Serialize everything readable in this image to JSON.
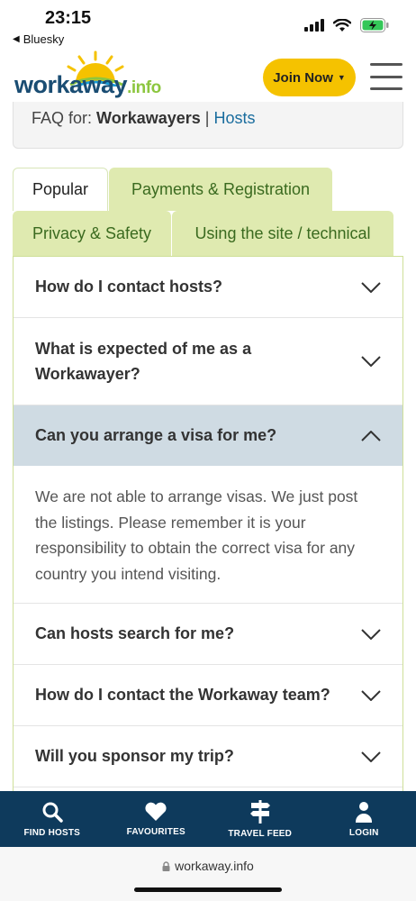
{
  "status_bar": {
    "time": "23:15",
    "back_app": "Bluesky"
  },
  "header": {
    "logo_main": "workaway",
    "logo_suffix": ".info",
    "join_label": "Join Now"
  },
  "faq_for": {
    "prefix": "FAQ for: ",
    "workawayers": "Workawayers",
    "separator": " | ",
    "hosts": "Hosts"
  },
  "tabs": [
    {
      "label": "Popular",
      "active": true
    },
    {
      "label": "Payments & Registration",
      "active": false
    },
    {
      "label": "Privacy & Safety",
      "active": false
    },
    {
      "label": "Using the site / technical",
      "active": false
    }
  ],
  "faq": [
    {
      "question": "How do I contact hosts?",
      "open": false
    },
    {
      "question": "What is expected of me as a Workawayer?",
      "open": false
    },
    {
      "question": "Can you arrange a visa for me?",
      "open": true,
      "answer": "We are not able to arrange visas. We just post the listings. Please remember it is your responsibility to obtain the correct visa for any country you intend visiting."
    },
    {
      "question": "Can hosts search for me?",
      "open": false
    },
    {
      "question": "How do I contact the Workaway team?",
      "open": false
    },
    {
      "question": "Will you sponsor my trip?",
      "open": false
    }
  ],
  "bottom_nav": [
    {
      "label": "FIND HOSTS",
      "icon": "search-icon"
    },
    {
      "label": "FAVOURITES",
      "icon": "heart-icon"
    },
    {
      "label": "TRAVEL FEED",
      "icon": "signpost-icon"
    },
    {
      "label": "LOGIN",
      "icon": "user-icon"
    }
  ],
  "browser": {
    "url": "workaway.info"
  },
  "colors": {
    "brand_blue": "#1a4d73",
    "brand_green": "#8cc63f",
    "join_yellow": "#f5c200",
    "tab_green": "#dfeab0",
    "nav_bg": "#0e3a5c",
    "open_row": "#cfdbe3"
  }
}
